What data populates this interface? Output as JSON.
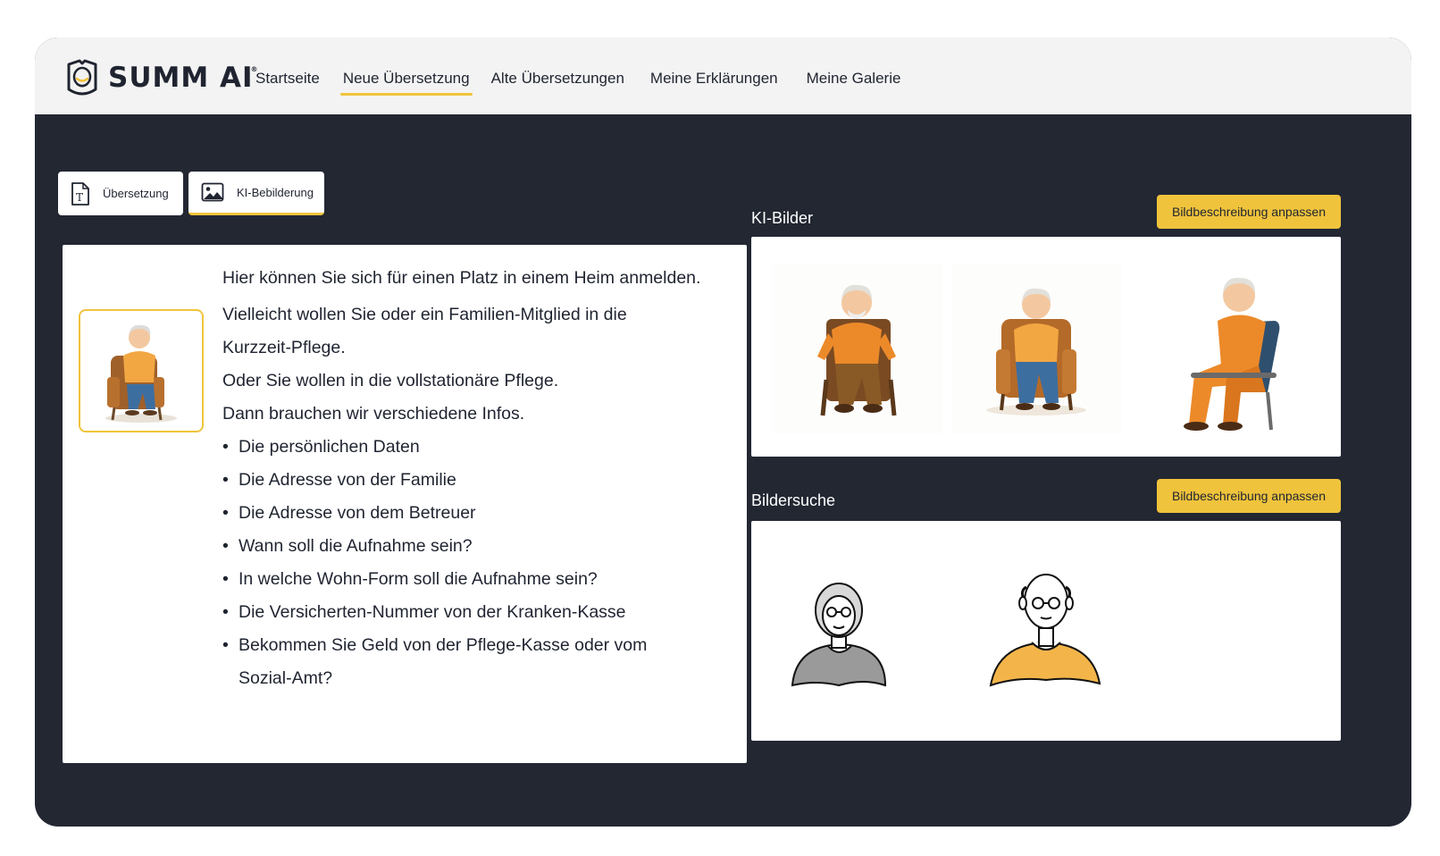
{
  "app": {
    "logo_text": "SUMM AI",
    "logo_mark": "®",
    "accent_color": "#f0c33c",
    "background_color": "#222732"
  },
  "nav": {
    "items": [
      {
        "label": "Startseite",
        "active": false
      },
      {
        "label": "Neue Übersetzung",
        "active": true
      },
      {
        "label": "Alte Übersetzungen",
        "active": false
      },
      {
        "label": "Meine Erklärungen",
        "active": false
      },
      {
        "label": "Meine Galerie",
        "active": false
      }
    ]
  },
  "tabs": [
    {
      "label": "Übersetzung",
      "icon": "text-document-icon",
      "active": false
    },
    {
      "label": "KI-Bebilderung",
      "icon": "image-icon",
      "active": true
    }
  ],
  "content": {
    "heading_line": "Hier können Sie sich für einen Platz in einem Heim anmelden.",
    "paragraphs": [
      "Vielleicht wollen Sie oder ein Familien-Mitglied in die",
      "Kurzzeit-Pflege.",
      "Oder Sie wollen in die vollstationäre Pflege.",
      "Dann brauchen wir verschiedene Infos."
    ],
    "bullets": [
      "Die persönlichen Daten",
      "Die Adresse von der Familie",
      "Die Adresse von dem Betreuer",
      "Wann soll die Aufnahme sein?",
      "In welche Wohn-Form soll die Aufnahme sein?",
      "Die Versicherten-Nummer von der Kranken-Kasse",
      "Bekommen Sie Geld von der Pflege-Kasse oder vom",
      "Sozial-Amt?"
    ]
  },
  "ki_bilder": {
    "title": "KI-Bilder",
    "button_label": "Bildbeschreibung anpassen",
    "images": [
      "seated-man-orange-shirt-brown-pants",
      "seated-man-orange-shirt-blue-jeans",
      "seated-man-orange-outfit-blue-chair"
    ]
  },
  "bildersuche": {
    "title": "Bildersuche",
    "button_label": "Bildbeschreibung anpassen",
    "images": [
      "woman-curly-hair-glasses-grey-top",
      "bald-man-glasses-orange-top"
    ]
  }
}
